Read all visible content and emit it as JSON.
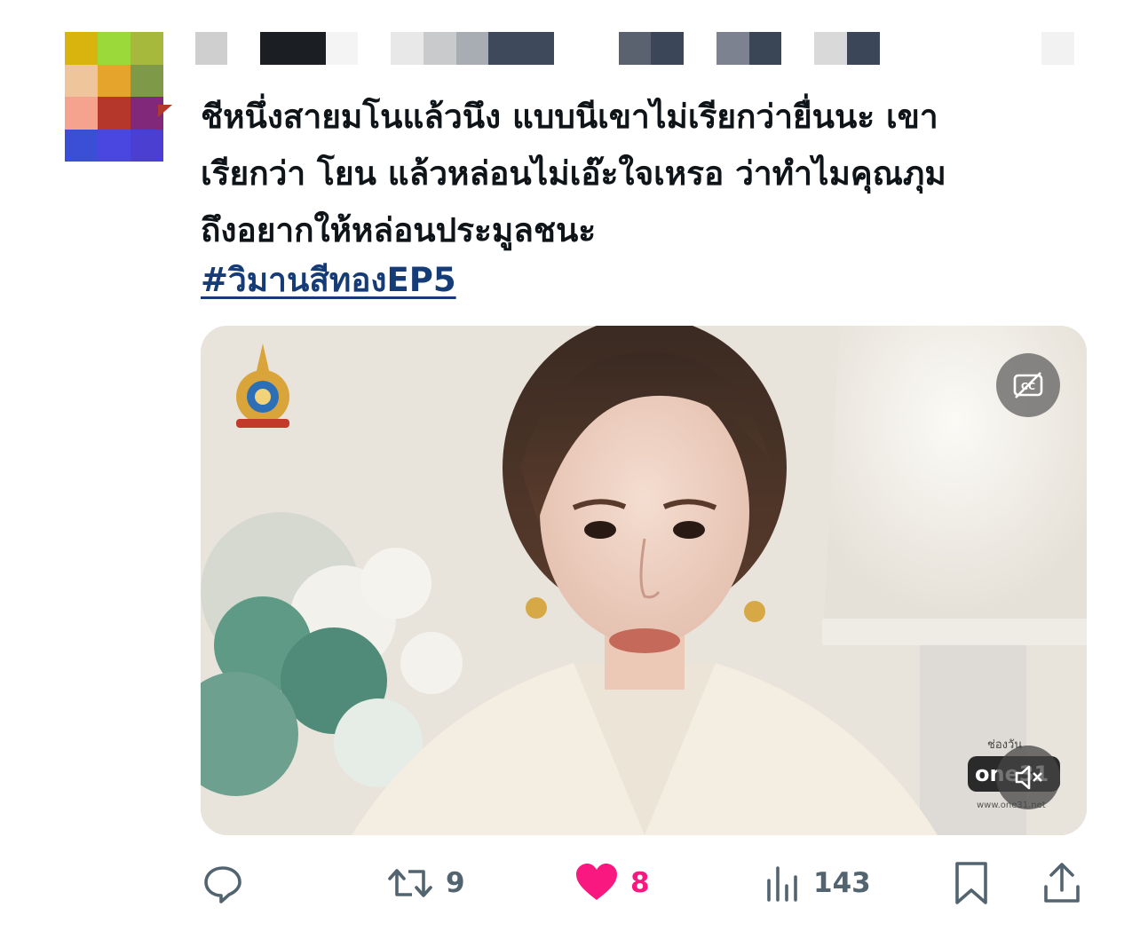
{
  "tweet": {
    "text_lines": [
      "ชีหนึ่งสายมโนแล้วนึง แบบนีเขาไม่เรียกว่ายื่นนะ เขา",
      "เรียกว่า โยน แล้วหล่อนไม่เอ๊ะใจเหรอ ว่าทำไมคุณภุม",
      "ถึงอยากให้หล่อนประมูลชนะ"
    ],
    "hashtag": "#วิมานสีทองEP5"
  },
  "author": {
    "avatar_pixels": [
      "#d9b40f",
      "#9bd83a",
      "#a6b93c",
      "#efc59c",
      "#e5a52c",
      "#7e9a48",
      "#f5a28f",
      "#b5362a",
      "#82287a",
      "#3a4fd6",
      "#4a47e0",
      "#4a3fd0"
    ],
    "name_bar_pixels": [
      "#cfcfcf",
      "#1b1e22",
      "#f4f4f4",
      "#e8e8e8",
      "#c9cacc",
      "#a8adb3",
      "#3e4a5c",
      "#5a6270",
      "#3b4658",
      "#7c8290",
      "#3a4556",
      "#d9d9d9",
      "#3b4658",
      "#f2f2f2"
    ]
  },
  "media": {
    "cc_icon": "closed-captions-off-icon",
    "mute_icon": "speaker-muted-icon",
    "channel": {
      "top_text": "ช่องวัน",
      "badge_text": "one31",
      "url_text": "www.one31.net"
    }
  },
  "actions": {
    "reply": {
      "icon": "reply-icon",
      "count": ""
    },
    "repost": {
      "icon": "repost-icon",
      "count": "9"
    },
    "like": {
      "icon": "heart-filled-icon",
      "count": "8",
      "color": "#f91880"
    },
    "views": {
      "icon": "views-bar-chart-icon",
      "count": "143"
    },
    "bookmark": {
      "icon": "bookmark-icon"
    },
    "share": {
      "icon": "share-upload-icon"
    }
  },
  "colors": {
    "text": "#0f1419",
    "hashtag": "#163c78",
    "muted": "#536471",
    "like": "#f91880"
  }
}
